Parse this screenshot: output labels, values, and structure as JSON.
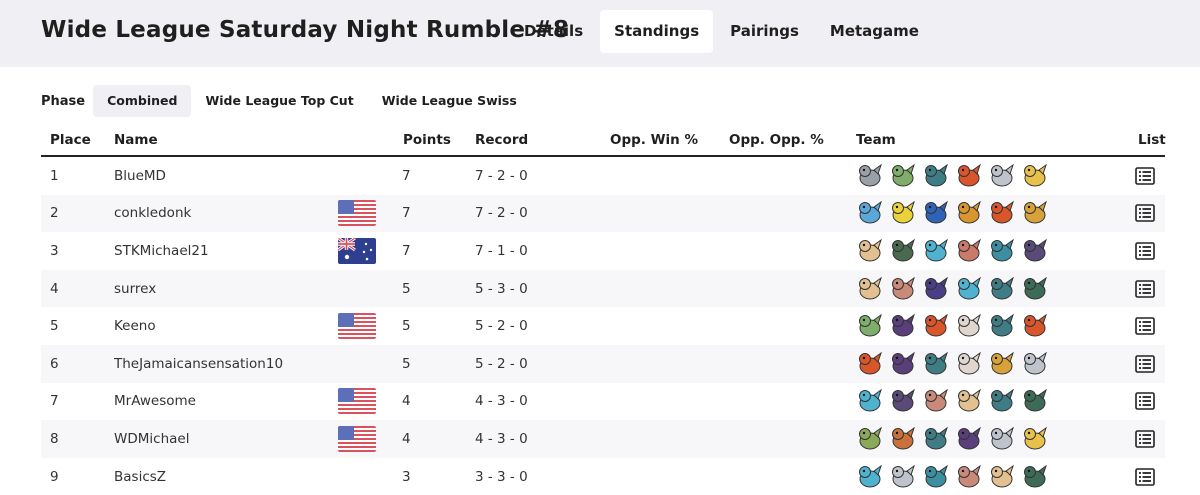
{
  "header": {
    "title": "Wide League Saturday Night Rumble #8",
    "tabs": [
      {
        "label": "Details",
        "active": false
      },
      {
        "label": "Standings",
        "active": true
      },
      {
        "label": "Pairings",
        "active": false
      },
      {
        "label": "Metagame",
        "active": false
      }
    ]
  },
  "phase": {
    "label": "Phase",
    "tabs": [
      {
        "label": "Combined",
        "active": true
      },
      {
        "label": "Wide League Top Cut",
        "active": false
      },
      {
        "label": "Wide League Swiss",
        "active": false
      }
    ]
  },
  "table": {
    "columns": {
      "place": "Place",
      "name": "Name",
      "points": "Points",
      "record": "Record",
      "opp_win": "Opp. Win %",
      "opp_opp": "Opp. Opp. %",
      "team": "Team",
      "list": "List"
    },
    "rows": [
      {
        "place": "1",
        "name": "BlueMD",
        "flag": "",
        "points": "7",
        "record": "7 - 2 - 0",
        "team": [
          "#9aa0a8",
          "#7fae6a",
          "#3f7d86",
          "#d9562b",
          "#bfc4cc",
          "#e8c14a"
        ]
      },
      {
        "place": "2",
        "name": "conkledonk",
        "flag": "us",
        "points": "7",
        "record": "7 - 2 - 0",
        "team": [
          "#5aa7d8",
          "#e9d23a",
          "#2f63b8",
          "#d9962e",
          "#d9562b",
          "#d7a23a"
        ]
      },
      {
        "place": "3",
        "name": "STKMichael21",
        "flag": "au",
        "points": "7",
        "record": "7 - 1 - 0",
        "team": [
          "#e3c08f",
          "#4a6a50",
          "#4fb3cf",
          "#c97a6a",
          "#3c8fa0",
          "#5a4a78"
        ]
      },
      {
        "place": "4",
        "name": "surrex",
        "flag": "",
        "points": "5",
        "record": "5 - 3 - 0",
        "team": [
          "#e3c08f",
          "#c98a7a",
          "#4a3f86",
          "#4fb3cf",
          "#3f7d86",
          "#3e6b58"
        ]
      },
      {
        "place": "5",
        "name": "Keeno",
        "flag": "us",
        "points": "5",
        "record": "5 - 2 - 0",
        "team": [
          "#7fae6a",
          "#5a3f7a",
          "#d9562b",
          "#e0d6d0",
          "#3f7d86",
          "#d9562b"
        ]
      },
      {
        "place": "6",
        "name": "TheJamaicansensation10",
        "flag": "",
        "points": "5",
        "record": "5 - 2 - 0",
        "team": [
          "#d9562b",
          "#5a3f7a",
          "#3f7d86",
          "#e0d6d0",
          "#d7a23a",
          "#bfc4cc"
        ]
      },
      {
        "place": "7",
        "name": "MrAwesome",
        "flag": "us",
        "points": "4",
        "record": "4 - 3 - 0",
        "team": [
          "#4fb3cf",
          "#5a4a78",
          "#c98a7a",
          "#e3c08f",
          "#3f7d86",
          "#3e6b58"
        ]
      },
      {
        "place": "8",
        "name": "WDMichael",
        "flag": "us",
        "points": "4",
        "record": "4 - 3 - 0",
        "team": [
          "#8aaa5a",
          "#c9713a",
          "#3f7d86",
          "#5a3f7a",
          "#bfc4cc",
          "#e8c14a"
        ]
      },
      {
        "place": "9",
        "name": "BasicsZ",
        "flag": "",
        "points": "3",
        "record": "3 - 3 - 0",
        "team": [
          "#4fb3cf",
          "#bfc4cc",
          "#3c8fa0",
          "#c98a7a",
          "#e3c08f",
          "#3e6b58"
        ]
      }
    ]
  }
}
